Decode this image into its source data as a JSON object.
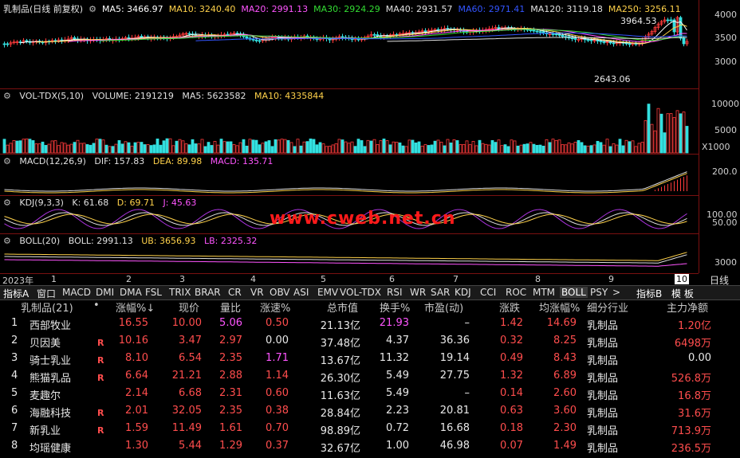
{
  "kline": {
    "title": "乳制品(日线 前复权)",
    "ma": [
      {
        "label": "MA5: 3466.97",
        "color": "#ffffff"
      },
      {
        "label": "MA10: 3240.40",
        "color": "#ffd24a"
      },
      {
        "label": "MA20: 2991.13",
        "color": "#ff55ff"
      },
      {
        "label": "MA30: 2924.29",
        "color": "#33dd33"
      },
      {
        "label": "MA40: 2931.57",
        "color": "#e0e0e0"
      },
      {
        "label": "MA60: 2971.41",
        "color": "#3355ff"
      },
      {
        "label": "MA120: 3119.18",
        "color": "#e0e0e0"
      },
      {
        "label": "MA250: 3256.11",
        "color": "#ffd24a"
      }
    ],
    "yticks": [
      "4000",
      "3500",
      "3000"
    ],
    "high_label": "3964.53",
    "low_label": "2643.06"
  },
  "volume": {
    "header": [
      "VOL-TDX(5,10)",
      "VOLUME: 2191219",
      "MA5: 5623582",
      "MA10: 4335844"
    ],
    "yticks": [
      "10000",
      "5000"
    ],
    "unit": "X1000"
  },
  "macd": {
    "header": [
      "MACD(12,26,9)",
      "DIF: 157.83",
      "DEA: 89.98",
      "MACD: 135.71"
    ],
    "ytick": "200.0"
  },
  "kdj": {
    "header": [
      "KDJ(9,3,3)",
      "K: 61.68",
      "D: 69.71",
      "J: 45.63"
    ],
    "yticks": [
      "100.00",
      "50.00"
    ]
  },
  "boll": {
    "header": [
      "BOLL(20)",
      "BOLL: 2991.13",
      "UB: 3656.93",
      "LB: 2325.32"
    ],
    "ytick": "3000"
  },
  "watermark": "www.cweb.net.cn",
  "timeaxis": {
    "year": "2023年",
    "months": [
      "1",
      "2",
      "3",
      "4",
      "5",
      "6",
      "7",
      "8",
      "9",
      "10"
    ],
    "period": "日线"
  },
  "tabs": [
    "指标A",
    "窗口",
    "MACD",
    "DMI",
    "DMA",
    "FSL",
    "TRIX",
    "BRAR",
    "CR",
    "VR",
    "OBV",
    "ASI",
    "EMV",
    "VOL-TDX",
    "RSI",
    "WR",
    "SAR",
    "KDJ",
    "CCI",
    "ROC",
    "MTM",
    "BOLL",
    "PSY",
    ">",
    "指标B",
    "模 板"
  ],
  "active_tab": "BOLL",
  "table": {
    "headers": [
      "乳制品(21)",
      "•",
      "涨幅%↓",
      "现价",
      "量比",
      "涨速%",
      "总市值",
      "换手%",
      "市盈(动)",
      "涨跌",
      "均涨幅%",
      "细分行业",
      "主力净额"
    ],
    "rows": [
      {
        "idx": "1",
        "name": "西部牧业",
        "flag": "",
        "chg": "16.55",
        "price": "10.00",
        "vr": "5.06",
        "spd": "0.50",
        "cap": "21.13亿",
        "turn": "21.93",
        "pe": "–",
        "diff": "1.42",
        "avg": "14.69",
        "ind": "乳制品",
        "net": "1.20亿"
      },
      {
        "idx": "2",
        "name": "贝因美",
        "flag": "R",
        "chg": "10.16",
        "price": "3.47",
        "vr": "2.97",
        "spd": "0.00",
        "cap": "37.48亿",
        "turn": "4.37",
        "pe": "36.36",
        "diff": "0.32",
        "avg": "8.25",
        "ind": "乳制品",
        "net": "6498万"
      },
      {
        "idx": "3",
        "name": "骑士乳业",
        "flag": "R",
        "chg": "8.10",
        "price": "6.54",
        "vr": "2.35",
        "spd": "1.71",
        "cap": "13.67亿",
        "turn": "11.32",
        "pe": "19.14",
        "diff": "0.49",
        "avg": "8.43",
        "ind": "乳制品",
        "net": "0.00"
      },
      {
        "idx": "4",
        "name": "熊猫乳品",
        "flag": "R",
        "chg": "6.64",
        "price": "21.21",
        "vr": "2.88",
        "spd": "1.14",
        "cap": "26.30亿",
        "turn": "5.49",
        "pe": "27.75",
        "diff": "1.32",
        "avg": "6.89",
        "ind": "乳制品",
        "net": "526.8万"
      },
      {
        "idx": "5",
        "name": "麦趣尔",
        "flag": "",
        "chg": "2.14",
        "price": "6.68",
        "vr": "2.31",
        "spd": "0.60",
        "cap": "11.63亿",
        "turn": "5.49",
        "pe": "–",
        "diff": "0.14",
        "avg": "2.60",
        "ind": "乳制品",
        "net": "16.8万"
      },
      {
        "idx": "6",
        "name": "海融科技",
        "flag": "R",
        "chg": "2.01",
        "price": "32.05",
        "vr": "2.35",
        "spd": "0.38",
        "cap": "28.84亿",
        "turn": "2.23",
        "pe": "20.81",
        "diff": "0.63",
        "avg": "3.60",
        "ind": "乳制品",
        "net": "31.6万"
      },
      {
        "idx": "7",
        "name": "新乳业",
        "flag": "R",
        "chg": "1.59",
        "price": "11.49",
        "vr": "1.61",
        "spd": "0.70",
        "cap": "98.89亿",
        "turn": "0.72",
        "pe": "16.68",
        "diff": "0.18",
        "avg": "2.30",
        "ind": "乳制品",
        "net": "713.9万"
      },
      {
        "idx": "8",
        "name": "均瑶健康",
        "flag": "",
        "chg": "1.30",
        "price": "5.44",
        "vr": "1.29",
        "spd": "0.37",
        "cap": "32.67亿",
        "turn": "1.00",
        "pe": "46.98",
        "diff": "0.07",
        "avg": "1.49",
        "ind": "乳制品",
        "net": "236.5万"
      }
    ]
  }
}
